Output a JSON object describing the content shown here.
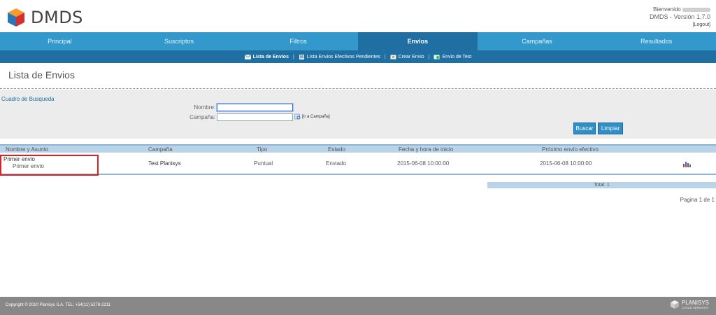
{
  "header": {
    "logo_text": "DMDS",
    "welcome": "Bienvenido",
    "version": "DMDS - Versión 1.7.0",
    "logout": "[Logout]"
  },
  "main_nav": [
    {
      "label": "Principal"
    },
    {
      "label": "Suscriptos"
    },
    {
      "label": "Filtros"
    },
    {
      "label": "Envios",
      "active": true
    },
    {
      "label": "Campañas"
    },
    {
      "label": "Resultados"
    }
  ],
  "sub_nav": [
    {
      "label": "Lista de Envios",
      "active": true,
      "icon": "envelope-icon"
    },
    {
      "label": "Lista Envios Efectivos Pendientes",
      "icon": "list-icon"
    },
    {
      "label": "Crear Envio",
      "icon": "create-icon"
    },
    {
      "label": "Envio de Test",
      "icon": "test-icon"
    }
  ],
  "page_title": "Lista de Envios",
  "search": {
    "title": "Cuadro de Busqueda",
    "nombre_label": "Nombre:",
    "nombre_value": "",
    "campana_label": "Campaña:",
    "campana_value": "",
    "campana_link": "[Ir a Campaña]",
    "buscar": "Buscar",
    "limpiar": "Limpiar"
  },
  "table": {
    "headers": [
      "Nombre y Asunto",
      "Campaña",
      "Tipo",
      "Estado",
      "Fecha y hora de inicio",
      "Próximo envío efectivo"
    ],
    "rows": [
      {
        "nombre": "Primer envio",
        "asunto": "Primer envio",
        "campana": "Test Planisys",
        "tipo": "Puntual",
        "estado": "Enviado",
        "inicio": "2015-06-08 10:00:00",
        "proximo": "2015-06-08 10:00:00",
        "action_icon": "bar-chart-icon"
      }
    ]
  },
  "total": "Total: 1",
  "pagination": "Pagina 1 de 1",
  "footer": {
    "copyright": "Copyright © 2010 Planisys S.A. TEL: +54(11) 5278-2211",
    "logo_name": "PLANISYS",
    "logo_sub": "CLOUD SERVICES"
  },
  "colors": {
    "nav_blue": "#3399cc",
    "nav_active": "#1f6fa3",
    "table_header": "#b9d3e8",
    "highlight_red": "#e02020",
    "footer_gray": "#888888"
  }
}
